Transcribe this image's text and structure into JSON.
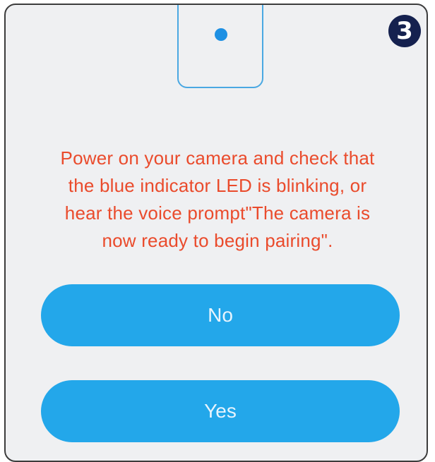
{
  "step": {
    "badge": "3"
  },
  "instruction": {
    "line1": "Power on your camera and check that",
    "line2": "the blue indicator LED is blinking, or",
    "line3": "hear the voice prompt\"The camera is",
    "line4": "now ready to begin pairing\"."
  },
  "buttons": {
    "no_label": "No",
    "yes_label": "Yes"
  },
  "colors": {
    "instruction_text": "#ea4b2c",
    "button_background": "#23a7ea",
    "indicator_led": "#1e90e3",
    "badge_background": "#15214f"
  },
  "icons": {
    "camera": "camera-outline-icon",
    "led": "blue-led-icon",
    "step": "step-number-badge"
  }
}
